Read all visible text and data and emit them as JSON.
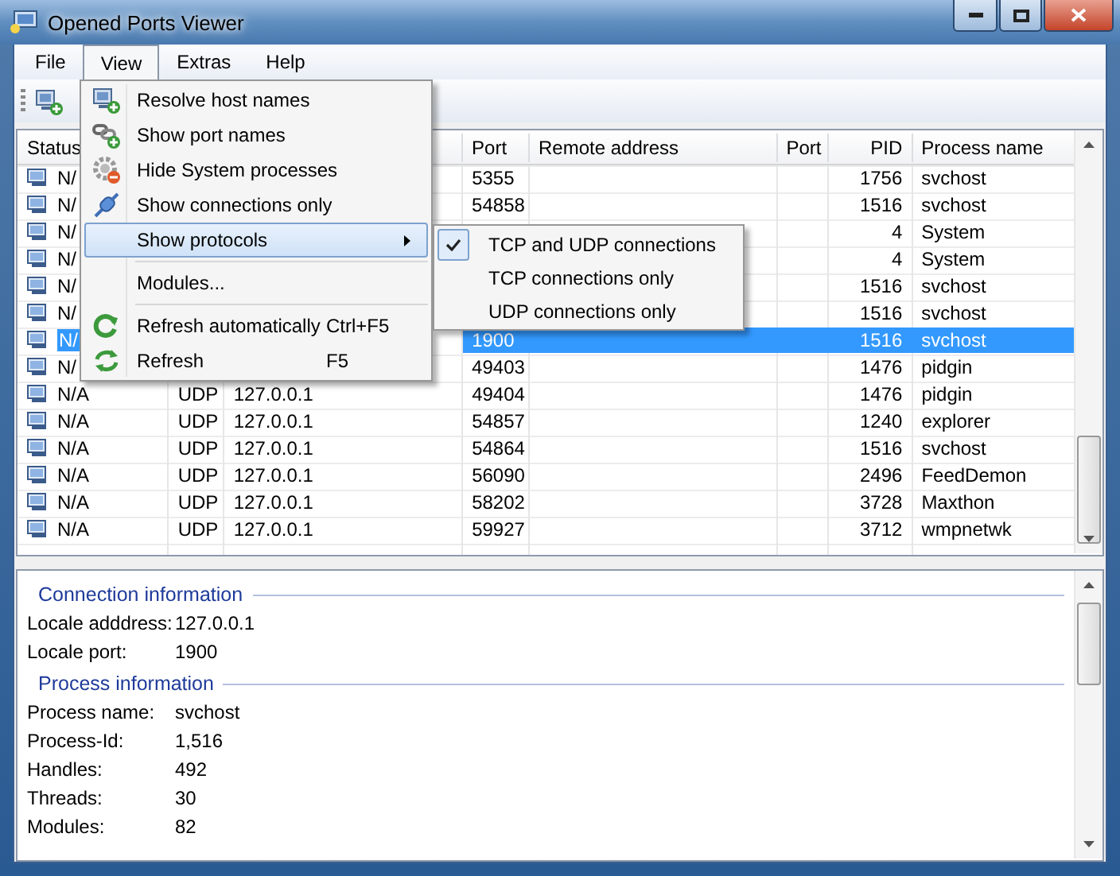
{
  "window": {
    "title": "Opened Ports Viewer"
  },
  "menubar": [
    {
      "label": "File",
      "selected": false
    },
    {
      "label": "View",
      "selected": true
    },
    {
      "label": "Extras",
      "selected": false
    },
    {
      "label": "Help",
      "selected": false
    }
  ],
  "table": {
    "columns": [
      "Status",
      "Port",
      "Remote address",
      "Port",
      "PID",
      "Process name"
    ],
    "rows": [
      {
        "status": "N/",
        "port": "5355",
        "pid": "1756",
        "process": "svchost",
        "selected": false
      },
      {
        "status": "N/",
        "port": "54858",
        "pid": "1516",
        "process": "svchost",
        "selected": false
      },
      {
        "status": "N/",
        "pid": "4",
        "process": "System",
        "selected": false
      },
      {
        "status": "N/",
        "pid": "4",
        "process": "System",
        "selected": false
      },
      {
        "status": "N/",
        "pid": "1516",
        "process": "svchost",
        "selected": false
      },
      {
        "status": "N/",
        "pid": "1516",
        "process": "svchost",
        "selected": false
      },
      {
        "status": "N/",
        "port": "1900",
        "pid": "1516",
        "process": "svchost",
        "selected": true
      },
      {
        "status": "N/",
        "port": "49403",
        "pid": "1476",
        "process": "pidgin",
        "selected": false
      },
      {
        "status": "N/A",
        "protocol": "UDP",
        "local": "127.0.0.1",
        "port": "49404",
        "pid": "1476",
        "process": "pidgin",
        "selected": false
      },
      {
        "status": "N/A",
        "protocol": "UDP",
        "local": "127.0.0.1",
        "port": "54857",
        "pid": "1240",
        "process": "explorer",
        "selected": false
      },
      {
        "status": "N/A",
        "protocol": "UDP",
        "local": "127.0.0.1",
        "port": "54864",
        "pid": "1516",
        "process": "svchost",
        "selected": false
      },
      {
        "status": "N/A",
        "protocol": "UDP",
        "local": "127.0.0.1",
        "port": "56090",
        "pid": "2496",
        "process": "FeedDemon",
        "selected": false
      },
      {
        "status": "N/A",
        "protocol": "UDP",
        "local": "127.0.0.1",
        "port": "58202",
        "pid": "3728",
        "process": "Maxthon",
        "selected": false
      },
      {
        "status": "N/A",
        "protocol": "UDP",
        "local": "127.0.0.1",
        "port": "59927",
        "pid": "3712",
        "process": "wmpnetwk",
        "selected": false
      }
    ]
  },
  "view_menu": [
    {
      "kind": "item",
      "label": "Resolve host names",
      "highlighted": false
    },
    {
      "kind": "item",
      "label": "Show port names",
      "highlighted": false
    },
    {
      "kind": "item",
      "label": "Hide System processes",
      "highlighted": false
    },
    {
      "kind": "item",
      "label": "Show connections only",
      "highlighted": false
    },
    {
      "kind": "submenu",
      "label": "Show protocols",
      "highlighted": true
    },
    {
      "kind": "separator"
    },
    {
      "kind": "item",
      "label": "Modules...",
      "highlighted": false
    },
    {
      "kind": "separator"
    },
    {
      "kind": "item",
      "label": "Refresh automatically",
      "shortcut": "Ctrl+F5",
      "highlighted": false
    },
    {
      "kind": "item",
      "label": "Refresh",
      "shortcut": "F5",
      "highlighted": false
    }
  ],
  "protocols_submenu": [
    {
      "label": "TCP and UDP connections",
      "checked": true
    },
    {
      "label": "TCP connections only",
      "checked": false
    },
    {
      "label": "UDP connections only",
      "checked": false
    }
  ],
  "details": [
    {
      "heading": "Connection information",
      "fields": [
        {
          "label": "Locale adddress:",
          "value": "127.0.0.1"
        },
        {
          "label": "Locale port:",
          "value": "1900"
        }
      ]
    },
    {
      "heading": "Process information",
      "fields": [
        {
          "label": "Process name:",
          "value": "svchost"
        },
        {
          "label": "Process-Id:",
          "value": "1,516"
        },
        {
          "label": "Handles:",
          "value": "492"
        },
        {
          "label": "Threads:",
          "value": "30"
        },
        {
          "label": "Modules:",
          "value": "82"
        }
      ]
    }
  ]
}
